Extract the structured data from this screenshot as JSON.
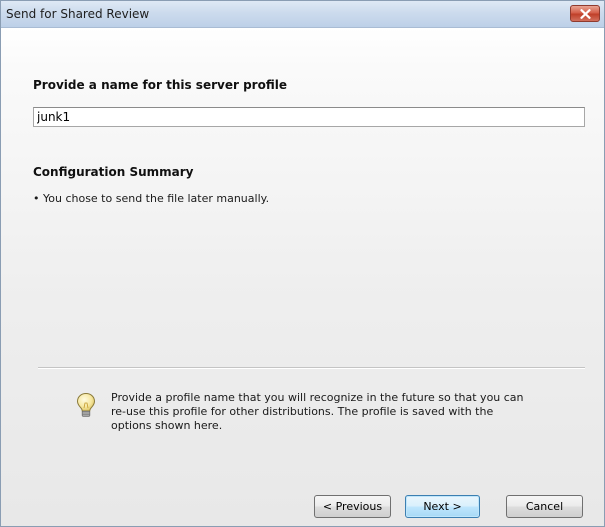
{
  "window": {
    "title": "Send for Shared Review"
  },
  "profile": {
    "heading": "Provide a name for this server profile",
    "name_value": "junk1"
  },
  "summary": {
    "heading": "Configuration Summary",
    "items": [
      "• You chose to send the file later manually."
    ]
  },
  "hint": {
    "icon": "lightbulb-icon",
    "text": "Provide a profile name that you will recognize in the future so that you can re-use this profile for other distributions. The profile is saved with the options shown here."
  },
  "buttons": {
    "previous": "< Previous",
    "next": "Next >",
    "cancel": "Cancel"
  },
  "colors": {
    "close_button": "#c7462f",
    "default_button_border": "#3c7fb1"
  }
}
